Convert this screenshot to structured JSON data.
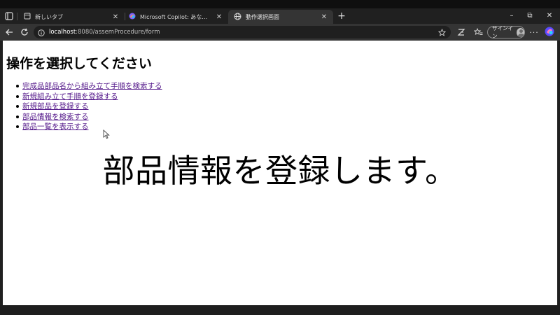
{
  "browser": {
    "tabs": [
      {
        "title": "新しいタブ",
        "icon": "page-icon",
        "active": false
      },
      {
        "title": "Microsoft Copilot: あなたの AI アシ",
        "icon": "copilot-icon",
        "active": false
      },
      {
        "title": "動作選択画面",
        "icon": "globe-icon",
        "active": true
      }
    ],
    "new_tab_label": "+",
    "window_controls": {
      "minimize": "–",
      "restore": "⧉",
      "close": "✕"
    },
    "address": {
      "host": "localhost",
      "rest": ":8080/assemProcedure/form"
    },
    "signin_label": "サインイン"
  },
  "page": {
    "title": "操作を選択してください",
    "links": [
      "完成品部品名から組み立て手順を検索する",
      "新規組み立て手順を登録する",
      "新規部品を登録する",
      "部品情報を検索する",
      "部品一覧を表示する"
    ],
    "message": "部品情報を登録します。"
  },
  "colors": {
    "tab_strip": "#202020",
    "toolbar": "#343434",
    "address_bar": "#1f1f1f",
    "visited_link": "#551a8b",
    "unvisited_link": "#1a0dab",
    "copilot_brand": "#7b61ff"
  }
}
